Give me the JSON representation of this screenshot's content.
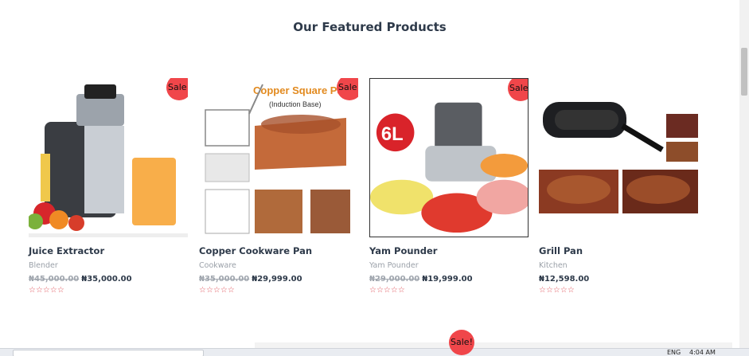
{
  "section": {
    "title": "Our Featured Products"
  },
  "products": [
    {
      "name": "Juice Extractor",
      "category": "Blender",
      "old_price": "₦45,000.00",
      "price": "₦35,000.00",
      "badge": "Sale!",
      "rating": "☆☆☆☆☆"
    },
    {
      "name": "Copper Cookware Pan",
      "category": "Cookware",
      "old_price": "₦35,000.00",
      "price": "₦29,999.00",
      "badge": "Sale!",
      "rating": "☆☆☆☆☆",
      "image_text": "Copper Square Pa",
      "image_subtext": "(Induction Base)"
    },
    {
      "name": "Yam Pounder",
      "category": "Yam Pounder",
      "old_price": "₦29,000.00",
      "price": "₦19,999.00",
      "badge": "Sale!",
      "rating": "☆☆☆☆☆",
      "image_text": "6L"
    },
    {
      "name": "Grill Pan",
      "category": "Kitchen",
      "old_price": "",
      "price": "₦12,598.00",
      "badge": "",
      "rating": "☆☆☆☆☆"
    }
  ],
  "next_row_badge": "Sale!",
  "taskbar": {
    "lang": "ENG",
    "time": "4:04 AM"
  },
  "colors": {
    "sale_badge": "#f0464a",
    "rating": "#e0525a"
  }
}
